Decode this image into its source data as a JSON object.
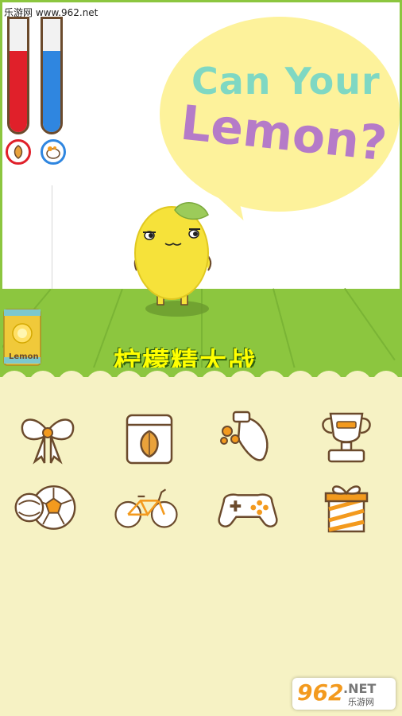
{
  "watermark": {
    "top_text": "乐游网 www.962.net"
  },
  "meters": [
    {
      "name": "hunger",
      "level": 0.72,
      "color": "#e0202a",
      "icon": "seed-icon"
    },
    {
      "name": "cleanliness",
      "level": 0.72,
      "color": "#2f86e0",
      "icon": "soap-icon"
    }
  ],
  "speech_bubble": {
    "line1": "Can Your",
    "line2": "Lemon?"
  },
  "game_title": "柠檬精大战",
  "can": {
    "label": "Lemon"
  },
  "items": [
    {
      "id": "bow",
      "icon": "bow-icon"
    },
    {
      "id": "food",
      "icon": "food-bag-icon"
    },
    {
      "id": "soap",
      "icon": "soap-bottle-icon"
    },
    {
      "id": "trophy",
      "icon": "trophy-icon"
    },
    {
      "id": "balls",
      "icon": "balls-icon"
    },
    {
      "id": "bike",
      "icon": "bicycle-icon"
    },
    {
      "id": "game",
      "icon": "gamepad-icon"
    },
    {
      "id": "gift",
      "icon": "gift-icon"
    }
  ],
  "footer_logo": {
    "big": "962",
    "net": ".NET",
    "cn": "乐游网"
  },
  "colors": {
    "floor": "#8cc63f",
    "panel": "#f6f2c4",
    "outline": "#6b4a2c",
    "accent": "#f39a1e"
  }
}
